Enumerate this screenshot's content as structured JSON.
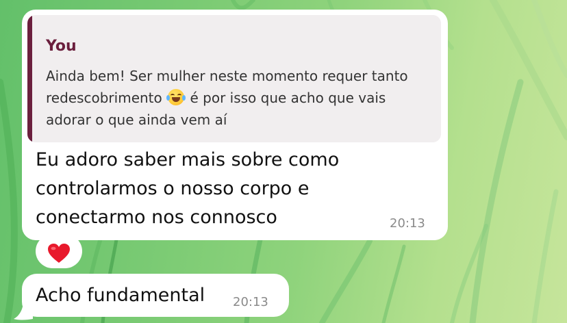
{
  "chat": {
    "background": "green grass wallpaper",
    "messages": [
      {
        "quote": {
          "author": "You",
          "text_before_emoji": "Ainda bem! Ser mulher neste momento requer tanto redescobrimento",
          "emoji": "face-with-tears-of-joy",
          "text_after_emoji": "é por isso que acho que vais adorar o que ainda vem aí"
        },
        "text": "Eu adoro saber mais sobre como controlarmos o nosso corpo e conectarmo nos connosco",
        "time": "20:13",
        "reaction": "red-heart"
      },
      {
        "text": "Acho fundamental",
        "time": "20:13"
      }
    ]
  },
  "colors": {
    "quote_accent": "#6b1f3d",
    "quote_background": "#f1eeef",
    "bubble": "#ffffff",
    "time": "#8a8a8a",
    "heart": "#e8192c"
  }
}
